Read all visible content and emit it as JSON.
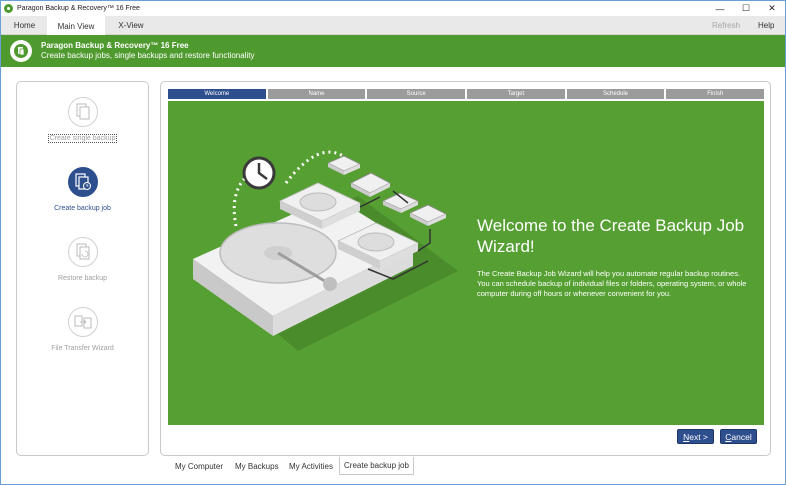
{
  "window": {
    "title": "Paragon Backup & Recovery™ 16 Free",
    "controls": {
      "minimize": "—",
      "maximize": "☐",
      "close": "✕"
    }
  },
  "menubar": {
    "tabs": [
      {
        "label": "Home",
        "active": false
      },
      {
        "label": "Main View",
        "active": true
      },
      {
        "label": "X-View",
        "active": false
      }
    ],
    "refresh": "Refresh",
    "help": "Help"
  },
  "banner": {
    "title": "Paragon Backup & Recovery™ 16 Free",
    "subtitle": "Create backup jobs, single backups and restore functionality"
  },
  "sidebar": {
    "items": [
      {
        "label": "Create single backup",
        "icon": "single-backup-icon",
        "state": "focused"
      },
      {
        "label": "Create backup job",
        "icon": "backup-job-icon",
        "state": "active"
      },
      {
        "label": "Restore backup",
        "icon": "restore-icon",
        "state": "normal"
      },
      {
        "label": "File Transfer Wizard",
        "icon": "file-transfer-icon",
        "state": "normal"
      }
    ]
  },
  "wizard": {
    "steps": [
      "Welcome",
      "Name",
      "Source",
      "Target",
      "Schedule",
      "Finish"
    ],
    "active_step": "Welcome",
    "headline": "Welcome to the Create Backup Job Wizard!",
    "description": "The Create Backup Job Wizard will help you automate regular backup routines. You can schedule backup of individual files or folders, operating system, or whole computer during off hours or whenever convenient for you.",
    "illustration": "hard-drive-backup-illustration",
    "background_color": "#56a033"
  },
  "buttons": {
    "next_mnemonic": "N",
    "next_rest": "ext >",
    "cancel_mnemonic": "C",
    "cancel_rest": "ancel"
  },
  "bottom_tabs": [
    {
      "label": "My Computer",
      "active": false
    },
    {
      "label": "My Backups",
      "active": false
    },
    {
      "label": "My Activities",
      "active": false
    },
    {
      "label": "Create backup job",
      "active": true
    }
  ],
  "colors": {
    "accent_green": "#4f9a2e",
    "accent_blue": "#2e4f8d",
    "step_inactive": "#9b9b9b"
  }
}
